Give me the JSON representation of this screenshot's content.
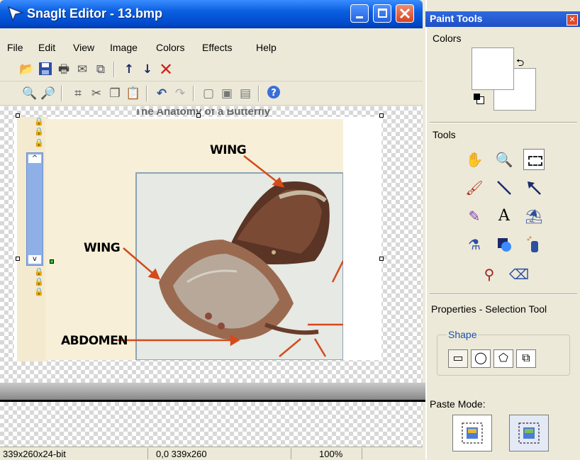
{
  "window": {
    "title": "SnagIt Editor - 13.bmp",
    "controls": [
      "minimize",
      "maximize",
      "close"
    ]
  },
  "menu": [
    "File",
    "Edit",
    "View",
    "Image",
    "Colors",
    "Effects",
    "Help"
  ],
  "toolbar1": [
    "open-icon",
    "save-icon",
    "print-icon",
    "send-icon",
    "catalog-icon",
    "up-arrow-icon",
    "down-arrow-icon",
    "delete-icon"
  ],
  "toolbar2": [
    "zoom-in-icon",
    "zoom-out-icon",
    "crop-icon",
    "cut-icon",
    "copy-icon",
    "paste-icon",
    "undo-icon",
    "redo-icon",
    "page1-icon",
    "page2-icon",
    "page3-icon",
    "help-icon"
  ],
  "image": {
    "title": "The Anatomy of a Butterfly",
    "labels": [
      "WING",
      "WING",
      "ABDOMEN"
    ]
  },
  "status": {
    "image_info": "339x260x24-bit",
    "position": "0,0 339x260",
    "zoom": "100%"
  },
  "paint_tools": {
    "title": "Paint Tools",
    "colors_label": "Colors",
    "tools_label": "Tools",
    "properties_label": "Properties - Selection Tool",
    "shape_label": "Shape",
    "paste_mode_label": "Paste Mode:",
    "foreground_color": "#ffffff",
    "background_color": "#ffffff",
    "tool_icons": [
      "hand-icon",
      "magnifier-icon",
      "selection-icon",
      "brush-icon",
      "line-icon",
      "arrow-icon",
      "pen-icon",
      "text-icon",
      "stamp-icon",
      "fill-icon",
      "shape-icon",
      "spray-icon",
      "dropper-icon",
      "eraser-icon"
    ]
  }
}
